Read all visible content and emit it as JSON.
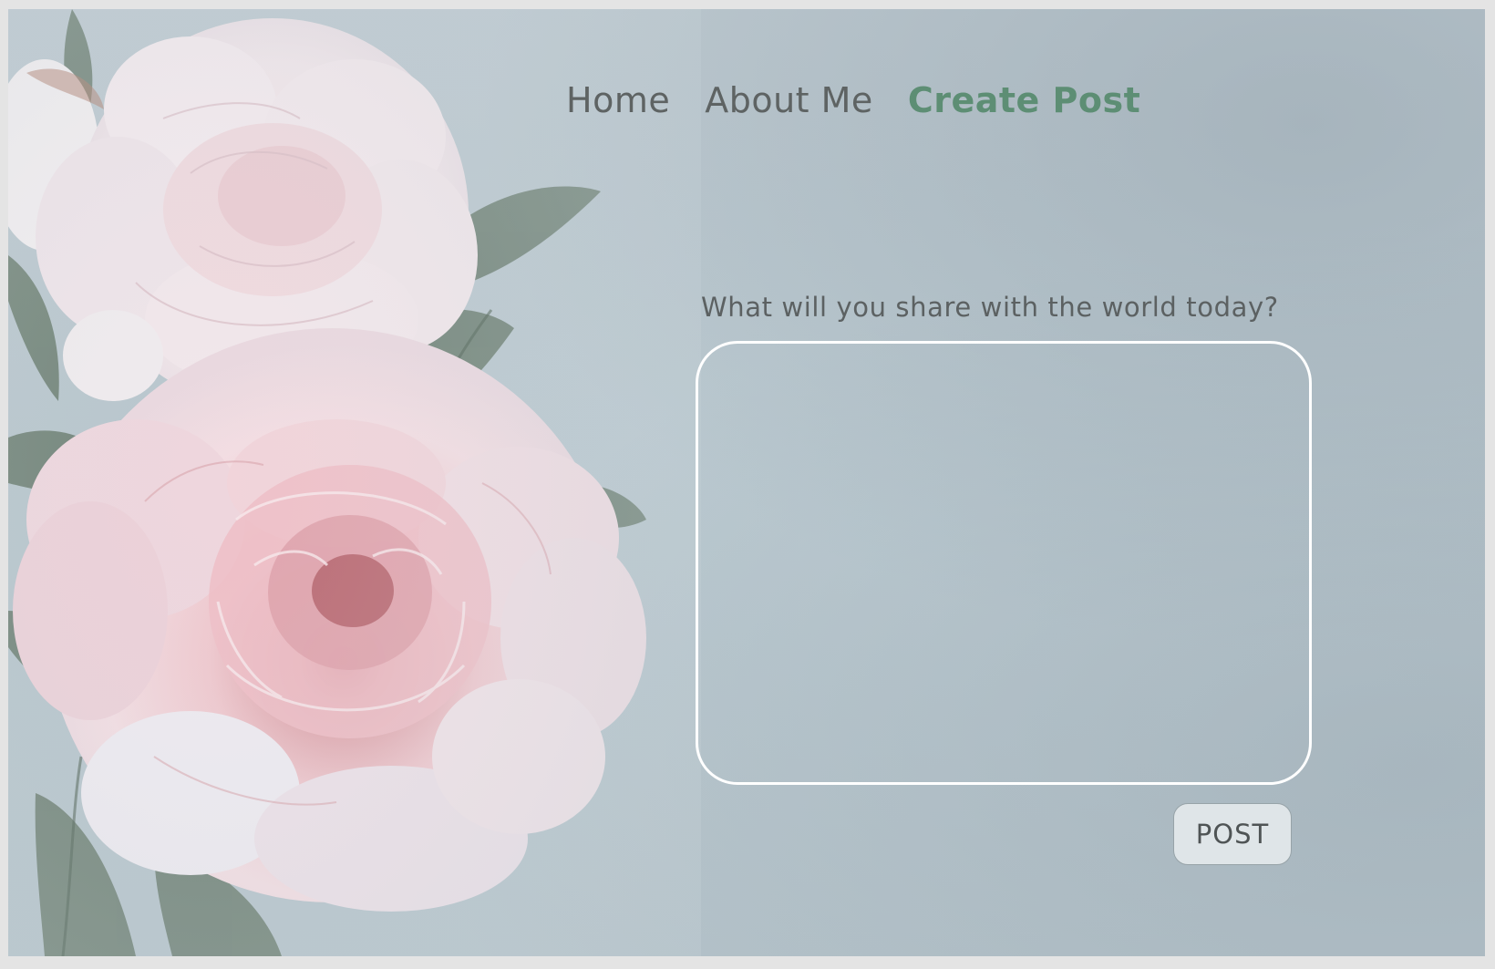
{
  "nav": {
    "items": [
      {
        "label": "Home",
        "active": false
      },
      {
        "label": "About Me",
        "active": false
      },
      {
        "label": "Create Post",
        "active": true
      }
    ]
  },
  "composer": {
    "prompt": "What will you share with the world today?",
    "value": "",
    "placeholder": "",
    "submit_label": "POST"
  },
  "colors": {
    "background": "#b7c5cc",
    "nav_text": "#5e6363",
    "nav_active": "#5d8e74",
    "textarea_border": "#ffffff",
    "button_bg": "#dfe5e8"
  },
  "icons": [
    "peony-flower-image"
  ]
}
